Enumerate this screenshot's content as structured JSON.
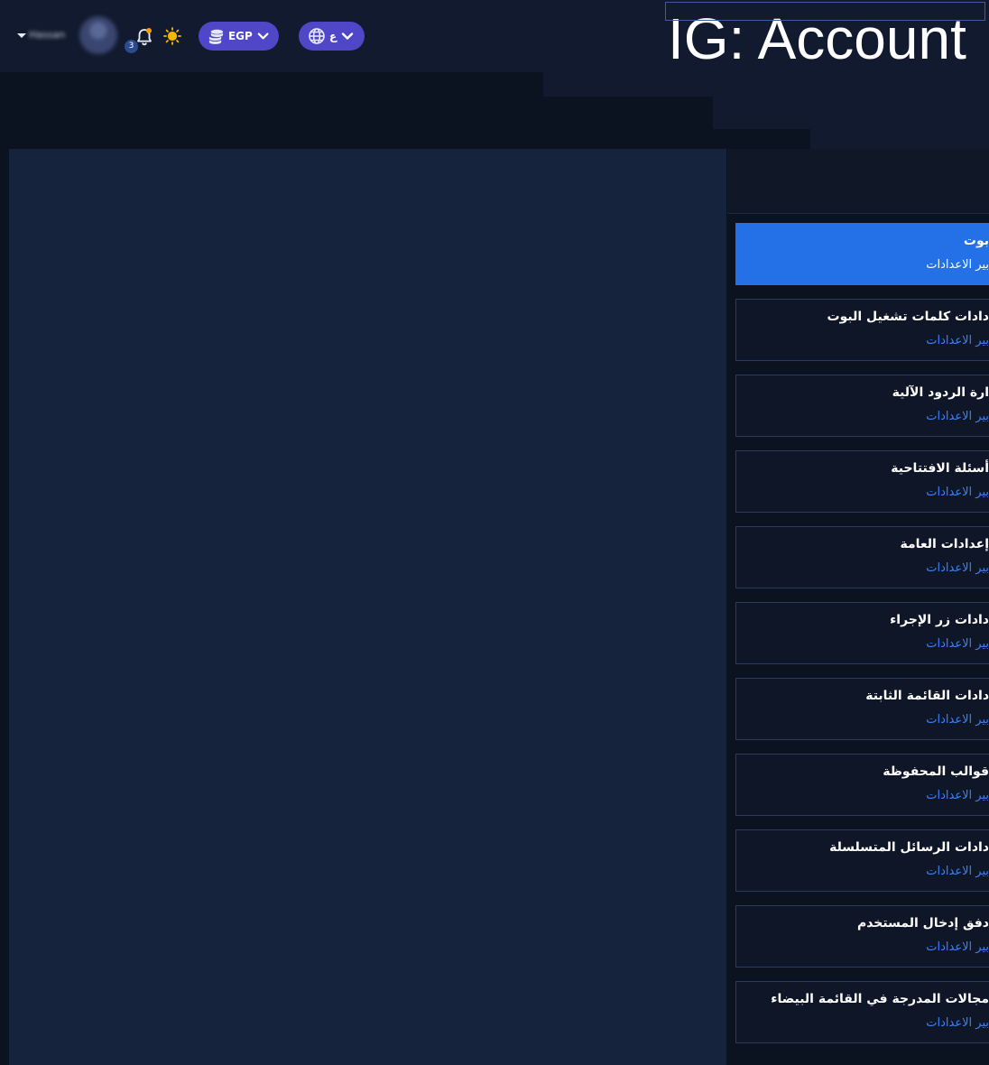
{
  "header": {
    "user_name": "Hassan",
    "notification_count": "3",
    "currency": {
      "label": "EGP"
    },
    "language": {
      "label": "ع"
    },
    "page_title": "IG: Account"
  },
  "settings": {
    "items": [
      {
        "title": "بوت",
        "link": "بير الاعدادات",
        "active": true
      },
      {
        "title": "دادات كلمات تشغيل البوت",
        "link": "بير الاعدادات",
        "active": false
      },
      {
        "title": "ارة الردود الآلية",
        "link": "بير الاعدادات",
        "active": false
      },
      {
        "title": "أسئلة الافتتاحية",
        "link": "بير الاعدادات",
        "active": false
      },
      {
        "title": "إعدادات العامة",
        "link": "بير الاعدادات",
        "active": false
      },
      {
        "title": "دادات زر الإجراء",
        "link": "بير الاعدادات",
        "active": false
      },
      {
        "title": "دادات القائمة الثابتة",
        "link": "بير الاعدادات",
        "active": false
      },
      {
        "title": "قوالب المحفوظة",
        "link": "بير الاعدادات",
        "active": false
      },
      {
        "title": "دادات الرسائل المتسلسلة",
        "link": "بير الاعدادات",
        "active": false
      },
      {
        "title": "دفق إدخال المستخدم",
        "link": "بير الاعدادات",
        "active": false
      },
      {
        "title": "مجالات المدرجة في القائمة البيضاء",
        "link": "بير الاعدادات",
        "active": false
      }
    ]
  },
  "colors": {
    "accent_pill": "#5046c8",
    "active_card": "#2470e6",
    "link": "#3b82f6",
    "notification_dot": "#f59e0b",
    "sun_icon": "#f5b800"
  },
  "icons": {
    "user_menu": "caret-down-icon",
    "notifications": "bell-icon",
    "theme": "sun-icon",
    "currency": "coins-icon",
    "language": "globe-icon",
    "dropdown": "chevron-down-icon"
  }
}
